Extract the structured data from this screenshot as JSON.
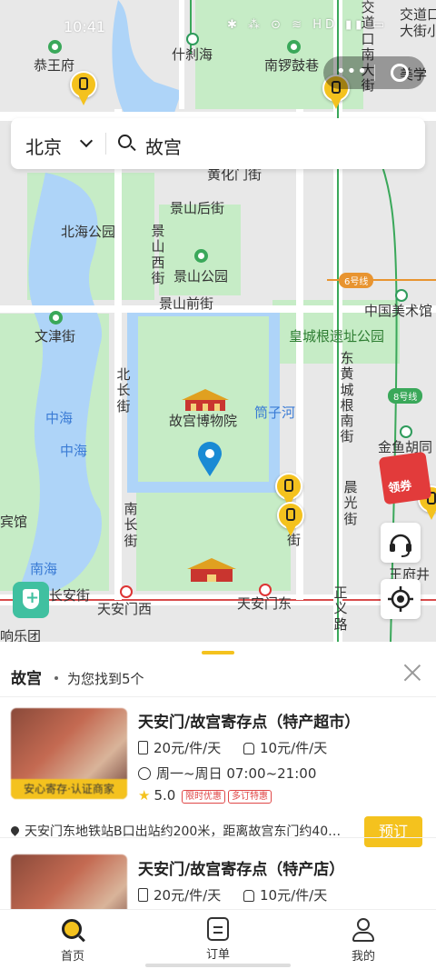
{
  "status_bar": {
    "time": "10:41",
    "icons": "✱ ⁂ ⊙ ≋ HD ▮▮ ▭"
  },
  "search": {
    "city": "北京",
    "query": "故宫"
  },
  "map": {
    "labels": {
      "gongwangfu": "恭王府",
      "shichahai": "什刹海",
      "nanluoguxiang": "南锣鼓巷",
      "jiaodaokou": "交道口",
      "jiaodaokou2": "大街小",
      "jiaodaokou_nan": "交道口南大街",
      "meixue": "美学",
      "huangbei": "黄化门街",
      "beihai": "北海公园",
      "jingshanhou": "景山后街",
      "jingshanxi": "景山西街",
      "jingshangongyuan": "景山公园",
      "jingshanqian": "景山前街",
      "wenjin": "文津街",
      "zhongguomeishuguan": "中国美术馆",
      "huangcheng": "皇城根遗址公园",
      "beichang": "北长街",
      "gugong": "故宫博物院",
      "tongzihe": "筒子河",
      "donghuang": "东黄城根南街",
      "zhonghai": "中海",
      "zhonghai2": "中海",
      "nanchang": "南长街",
      "chenguang": "晨光街",
      "jinyu": "金鱼胡同",
      "jie": "街",
      "nanhai": "南海",
      "changan": "长安街",
      "tiananmenxi": "天安门西",
      "tiananmendong": "天安门东",
      "zhengyi": "正义路",
      "wangfujing": "王府井",
      "binguan": "宾馆",
      "xiangle": "响乐团",
      "line6": "6号线",
      "line8": "8号线",
      "line6b": "6号线"
    }
  },
  "coupon": {
    "label": "领券"
  },
  "sheet": {
    "title": "故宫",
    "result_text": "为您找到5个"
  },
  "cards": [
    {
      "title": "天安门/故宫寄存点（特产超市）",
      "price_box": "20元/件/天",
      "price_bag": "10元/件/天",
      "hours": "周一~周日 07:00~21:00",
      "rating": "5.0",
      "badge1": "限时优惠",
      "badge2": "多订特惠",
      "tag": "安心寄存·认证商家",
      "address": "天安门东地铁站B口出站约200米，距离故宫东门约40…",
      "book": "预订"
    },
    {
      "title": "天安门/故宫寄存点（特产店）",
      "price_box": "20元/件/天",
      "price_bag": "10元/件/天"
    }
  ],
  "tabbar": [
    {
      "label": "首页"
    },
    {
      "label": "订单"
    },
    {
      "label": "我的"
    }
  ],
  "colors": {
    "accent": "#f4c21e",
    "water": "#aed4f8",
    "park": "#c6ecc6"
  }
}
